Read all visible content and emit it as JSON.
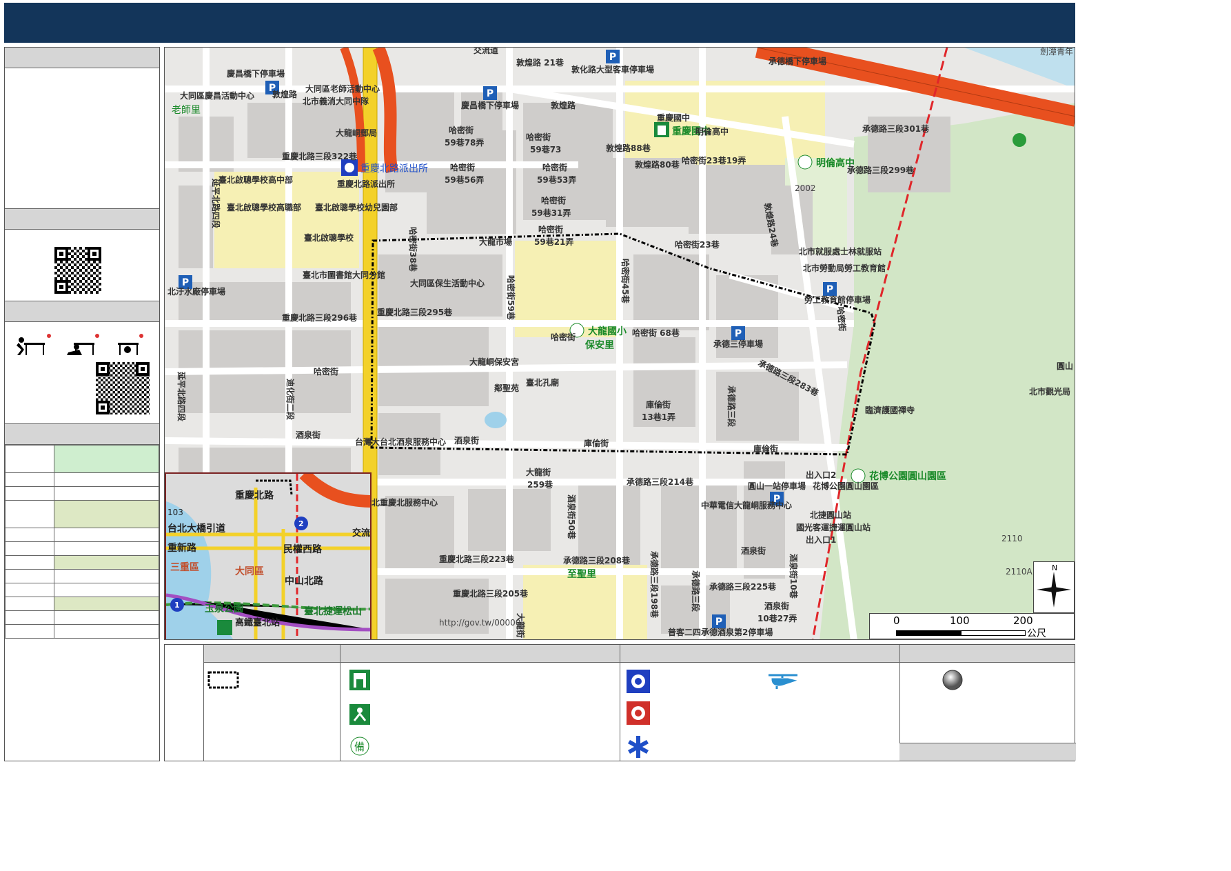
{
  "map": {
    "labels": {
      "jiaoliudao": "交流道",
      "dunhuang_21": "敦煌路 21巷",
      "dunhua_bus": "敦化路大型客車停車場",
      "chengde_parking": "承德橋下停車場",
      "jiantan": "劍潭青年",
      "qingchang_parking": "慶昌橋下停車場",
      "datong_elder_center": "大同區老師活動中心",
      "datong_qingchang_center": "大同區慶昌活動中心",
      "dunhuang_road": "敦煌路",
      "laoshi_li": "老師里",
      "fire_brigade": "北市義消大同中隊",
      "nongchang_parking": "慶昌橋下停車場",
      "dunhuang_road2": "敦煌路",
      "chongqing_jh": "重慶國中",
      "chongqing_jh_big": "重慶國中",
      "minglun_jh": "明倫高中",
      "minglun_hs": "明倫高中",
      "chengde_301": "承德路三段301巷",
      "chengde_299": "承德路三段299巷",
      "dalong_post": "大龍峒郵局",
      "hami_59_78": "哈密街",
      "hami_59_78b": "59巷78弄",
      "hami_59_73": "哈密街",
      "hami_59_73b": "59巷73",
      "dunhuang_88": "敦煌路88巷",
      "dunhuang_80": "敦煌路80巷",
      "hami_23_19": "哈密街23巷19弄",
      "chongqing_322": "重慶北路三段322巷",
      "chongqing_police": "重慶北路派出所",
      "chongqing_police_small": "重慶北路派出所",
      "hami_59_56": "哈密街",
      "hami_59_56b": "59巷56弄",
      "hami_59_53": "哈密街",
      "hami_59_53b": "59巷53弄",
      "hami_59_31": "哈密街",
      "hami_59_31b": "59巷31弄",
      "hami_59_21": "哈密街",
      "hami_59_21b": "59巷21弄",
      "yanping_4": "延平北路四段",
      "deaf_school_jh": "臺北啟聰學校高中部",
      "deaf_school_hs": "臺北啟聰學校高職部",
      "deaf_school_k": "臺北啟聰學校幼兒園部",
      "deaf_school": "臺北啟聰學校",
      "hami_38": "哈密街38巷",
      "dalong_market": "大龍市場",
      "dunhuang_24": "敦煌路24巷",
      "shilin_center": "北市就服處士林就服站",
      "labor_school": "北市勞動局勞工教育館",
      "hami_23": "哈密街23巷",
      "water_parking": "北汙水廠停車場",
      "library": "臺北市圖書館大同分館",
      "datong_health": "大同區保生活動中心",
      "hami_59": "哈密街59巷",
      "hami_45": "哈密街45巷",
      "labor_parking": "勞工教育館停車場",
      "chongqing_296": "重慶北路三段296巷",
      "chongqing_295": "重慶北路三段295巷",
      "dalong_es": "大龍國小",
      "baoan_li": "保安里",
      "hami_68": "哈密街 68巷",
      "hami_street": "哈密街",
      "chengde_parking2": "承德三停車場",
      "chengde_283": "承德路三段283巷",
      "hami_st_right": "哈密街",
      "dalong_temple": "大龍峒保安宮",
      "confucius": "臺北孔廟",
      "linji_temple": "臨濟護國禪寺",
      "yuanshan": "圓山",
      "tourism": "北市觀光局",
      "hami_st2": "哈密街",
      "dihua_2": "迪化街二段",
      "yanping_4b": "延平北路四段",
      "liyuan": "鄰聖苑",
      "chengde_3": "承德路三段",
      "kulun_13_1": "庫倫街",
      "kulun_13_1b": "13巷1弄",
      "jiuquan": "酒泉街",
      "taipei_hotel": "台灣大台北酒泉服務中心",
      "jiuquan2": "酒泉街",
      "kulun": "庫倫街",
      "kulun2": "庫倫街",
      "exit2": "出入口2",
      "expo_park": "花博公園圓山園區",
      "expo_park_small": "花博公園圓山園區",
      "dalong_259": "大龍街",
      "dalong_259b": "259巷",
      "chengde_214": "承德路三段214巷",
      "yuanshan_parking": "圓山一站停車場",
      "chinese_service": "中華電信大龍峒服務中心",
      "north_service": "北重慶北服務中心",
      "yuanshan_mrt": "北捷圓山站",
      "guoguang_bus": "國光客運捷運圓山站",
      "exit1": "出入口1",
      "jiuquan_50": "酒泉街50巷",
      "jiuquan_st": "酒泉街",
      "jiuquan_10": "酒泉街10巷",
      "chongqing_223": "重慶北路三段223巷",
      "chengde_208": "承德路三段208巷",
      "chengde_198": "承德路三段198巷",
      "chengde_3b": "承德路三段",
      "chengde_225": "承德路三段225巷",
      "zhisheng_li": "至聖里",
      "chongqing_205": "重慶北路三段205巷",
      "jiuquan_27": "酒泉街",
      "jiuquan_27b": "10巷27弄",
      "dalong_st": "大龍街",
      "puke_parking": "普客二四承德酒泉第2停車場",
      "elev_2002": "2002",
      "elev_2110": "2110",
      "elev_2110a": "2110A",
      "watermark": "http://gov.tw/00000"
    },
    "inset": {
      "chongqing_n": "重慶北路",
      "taipei_bridge": "台北大橋引道",
      "sanchong_rd": "重新路",
      "minquan_w": "民權西路",
      "sanchong": "三重區",
      "datong": "大同區",
      "zhongshan_n": "中山北路",
      "yuquan": "玉泉公園",
      "mrt_songshan": "臺北捷運松山",
      "hsr": "高鐵臺北站",
      "jiaoliu": "交流",
      "route_103": "103",
      "route_2": "2",
      "route_1": "1"
    },
    "scale": {
      "s0": "0",
      "s100": "100",
      "s200": "200",
      "unit": "公尺"
    },
    "compass_n": "N"
  },
  "colors": {
    "header": "#13355a",
    "freeway": "#e8501f",
    "arterial": "#f3d12a",
    "mrt": "#e0262a",
    "park": "#d2e6c6",
    "school": "#f6f0b4",
    "green_cell": "#cfeecf",
    "olive_cell": "#dde8c4"
  },
  "icons": [
    "shelter-icon",
    "evacuation-icon",
    "reserve-shelter-icon",
    "police-icon",
    "fire-dept-icon",
    "medical-icon",
    "helipad-icon",
    "gather-point-icon",
    "parking-icon"
  ]
}
